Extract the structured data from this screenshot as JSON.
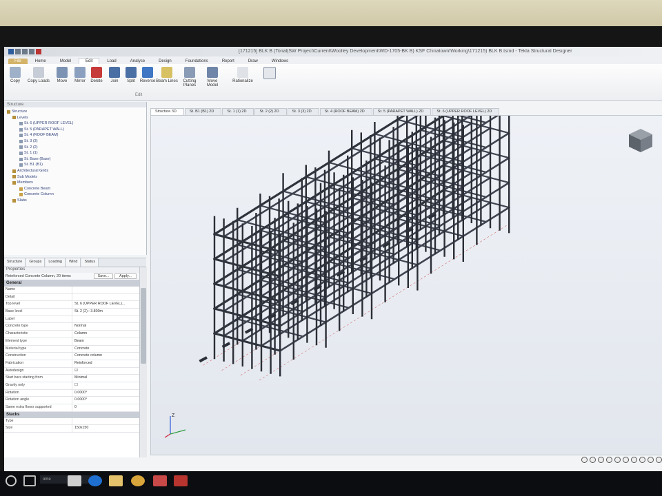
{
  "window": {
    "title": "[171215] BLK B (Tonal(SW Project\\Current\\Woolley Development\\WD-1705-BK B) KSF Chinatown\\Working\\171215) BLK B.tsmd - Tekla Structural Designer"
  },
  "ribbon": {
    "tabs": [
      "File",
      "Home",
      "Model",
      "Edit",
      "Load",
      "Analyse",
      "Design",
      "Foundations",
      "Report",
      "Draw",
      "Windows"
    ],
    "active_tab": "Edit",
    "buttons": [
      "Copy",
      "Copy Loads",
      "Move",
      "Mirror",
      "Delete",
      "Join",
      "Split",
      "Reverse",
      "Beam Lines",
      "Cutting Planes",
      "Move Model",
      "Rationalize"
    ],
    "group_label": "Edit"
  },
  "structure_tree": {
    "header": "Structure",
    "items": [
      "Structure",
      "Levels",
      "St. 6 (UPPER ROOF LEVEL)",
      "St. 5 (PARAPET WALL)",
      "St. 4 (ROOF BEAM)",
      "St. 3 (3)",
      "St. 2 (2)",
      "St. 1 (1)",
      "St. Base (Base)",
      "St. B1 (B1)",
      "Architectural Grids",
      "Sub Models",
      "Members",
      "Concrete Beam",
      "Concrete Column",
      "Slabs"
    ]
  },
  "panel_tabs": [
    "Structure",
    "Groups",
    "Loading",
    "Wind",
    "Status"
  ],
  "properties": {
    "header": "Properties",
    "selection": "Reinforced Concrete Column, 20 items",
    "save_label": "Save...",
    "apply_label": "Apply...",
    "group_general": "General",
    "rows": [
      {
        "k": "Name",
        "v": ""
      },
      {
        "k": "Detail",
        "v": ""
      },
      {
        "k": "Top level",
        "v": "St. 6 (UPPER ROOF LEVEL)..."
      },
      {
        "k": "Base level",
        "v": "St. 2 (2) : 3.800m"
      },
      {
        "k": "Label",
        "v": ""
      },
      {
        "k": "Concrete type",
        "v": "Normal"
      },
      {
        "k": "Characteristic",
        "v": "Column"
      },
      {
        "k": "Element type",
        "v": "Beam"
      },
      {
        "k": "Material type",
        "v": "Concrete"
      },
      {
        "k": "Construction",
        "v": "Concrete column"
      },
      {
        "k": "Fabrication",
        "v": "Reinforced"
      },
      {
        "k": "Autodesign",
        "v": "☑"
      },
      {
        "k": "Start bars starting from",
        "v": "Minimal"
      },
      {
        "k": "Gravity only",
        "v": "☐"
      },
      {
        "k": "Rotation",
        "v": "0.0000°"
      },
      {
        "k": "Rotation angle",
        "v": "0.0000°"
      },
      {
        "k": "Same extra floors supported",
        "v": "0"
      }
    ],
    "group_stacks": "Stacks",
    "rows2": [
      {
        "k": "Type",
        "v": ""
      },
      {
        "k": "Size",
        "v": "150x150"
      }
    ]
  },
  "doc_tabs": [
    "Structure 3D",
    "St. B1 (B1) 2D",
    "St. 1 (1) 2D",
    "St. 2 (2) 2D",
    "St. 3 (3) 2D",
    "St. 4 (ROOF BEAM) 2D",
    "St. 5 (PARAPET WALL) 2D",
    "St. 6 (UPPER ROOF LEVEL) 2D"
  ],
  "taskbar": {
    "search_text": "ome"
  }
}
